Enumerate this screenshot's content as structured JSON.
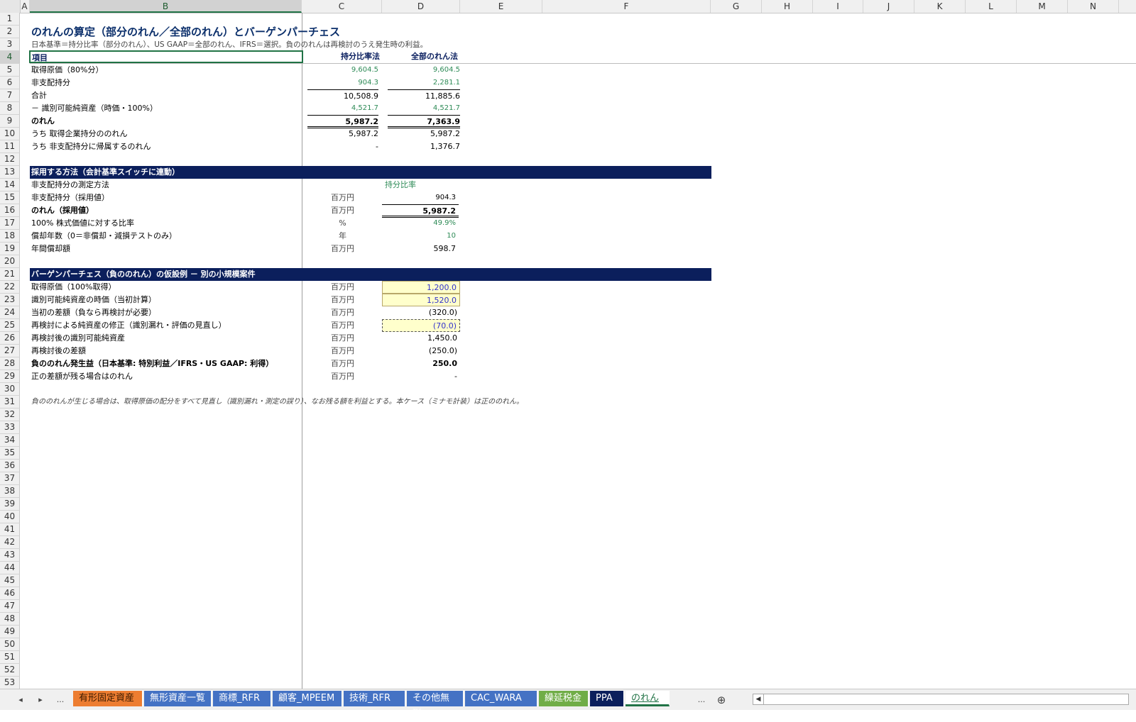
{
  "columns": [
    "A",
    "B",
    "C",
    "D",
    "E",
    "F",
    "G",
    "H",
    "I",
    "J",
    "K",
    "L",
    "M",
    "N"
  ],
  "rows": [
    "1",
    "2",
    "3",
    "4",
    "5",
    "6",
    "7",
    "8",
    "9",
    "10",
    "11",
    "12",
    "13",
    "14",
    "15",
    "16",
    "17",
    "18",
    "19",
    "20",
    "21",
    "22",
    "23",
    "24",
    "25",
    "26",
    "27",
    "28",
    "29",
    "30",
    "31",
    "32",
    "33",
    "34",
    "35",
    "36",
    "37",
    "38",
    "39",
    "40",
    "41",
    "42",
    "43",
    "44",
    "45",
    "46",
    "47",
    "48",
    "49",
    "50",
    "51",
    "52",
    "53"
  ],
  "title": "のれんの算定（部分のれん／全部のれん）とバーゲンパーチェス",
  "subtitle": "日本基準＝持分比率（部分のれん）、US GAAP＝全部のれん、IFRS＝選択。負ののれんは再検討のうえ発生時の利益。",
  "table1": {
    "header": {
      "item": "項目",
      "col_c": "持分比率法",
      "col_d": "全部のれん法"
    },
    "rows": [
      {
        "label": "取得原価（80%分）",
        "c": "9,604.5",
        "d": "9,604.5"
      },
      {
        "label": "非支配持分",
        "c": "904.3",
        "d": "2,281.1"
      },
      {
        "label": "合計",
        "c": "10,508.9",
        "d": "11,885.6"
      },
      {
        "label": "－ 識別可能純資産（時価・100%）",
        "c": "4,521.7",
        "d": "4,521.7"
      },
      {
        "label": "のれん",
        "c": "5,987.2",
        "d": "7,363.9"
      },
      {
        "label": "うち 取得企業持分ののれん",
        "c": "5,987.2",
        "d": "5,987.2"
      },
      {
        "label": "うち 非支配持分に帰属するのれん",
        "c": "-",
        "d": "1,376.7"
      }
    ]
  },
  "section2": {
    "header": "採用する方法（会計基準スイッチに連動）",
    "rows": [
      {
        "label": "非支配持分の測定方法",
        "unit": "",
        "value": "持分比率"
      },
      {
        "label": "非支配持分（採用値）",
        "unit": "百万円",
        "value": "904.3"
      },
      {
        "label": "のれん（採用値）",
        "unit": "百万円",
        "value": "5,987.2"
      },
      {
        "label": "100% 株式価値に対する比率",
        "unit": "%",
        "value": "49.9%"
      },
      {
        "label": "償却年数（0＝非償却・減損テストのみ）",
        "unit": "年",
        "value": "10"
      },
      {
        "label": "年間償却額",
        "unit": "百万円",
        "value": "598.7"
      }
    ]
  },
  "section3": {
    "header": "バーゲンパーチェス（負ののれん）の仮設例 － 別の小規模案件",
    "rows": [
      {
        "label": "取得原価（100%取得）",
        "unit": "百万円",
        "value": "1,200.0"
      },
      {
        "label": "識別可能純資産の時価（当初計算）",
        "unit": "百万円",
        "value": "1,520.0"
      },
      {
        "label": "当初の差額（負なら再検討が必要）",
        "unit": "百万円",
        "value": "(320.0)"
      },
      {
        "label": "再検討による純資産の修正（識別漏れ・評価の見直し）",
        "unit": "百万円",
        "value": "(70.0)"
      },
      {
        "label": "再検討後の識別可能純資産",
        "unit": "百万円",
        "value": "1,450.0"
      },
      {
        "label": "再検討後の差額",
        "unit": "百万円",
        "value": "(250.0)"
      },
      {
        "label": "負ののれん発生益（日本基準: 特別利益／IFRS・US GAAP: 利得）",
        "unit": "百万円",
        "value": "250.0"
      },
      {
        "label": "正の差額が残る場合はのれん",
        "unit": "百万円",
        "value": "-"
      }
    ]
  },
  "note": "負ののれんが生じる場合は、取得原価の配分をすべて見直し（識別漏れ・測定の誤り）、なお残る額を利益とする。本ケース（ミナモ計装）は正ののれん。",
  "tabs": [
    {
      "label": "有形固定資産",
      "color": "#ed7d31"
    },
    {
      "label": "無形資産一覧",
      "color": "#4472c4"
    },
    {
      "label": "商標_RFR",
      "color": "#4472c4"
    },
    {
      "label": "顧客_MPEEM",
      "color": "#4472c4"
    },
    {
      "label": "技術_RFR",
      "color": "#4472c4"
    },
    {
      "label": "その他無形",
      "color": "#4472c4"
    },
    {
      "label": "CAC_WARA",
      "color": "#4472c4"
    },
    {
      "label": "繰延税金",
      "color": "#70ad47"
    },
    {
      "label": "PPA",
      "color": "#0b1f5c"
    },
    {
      "label": "のれん",
      "color": "#ffffff"
    }
  ],
  "tabnav": {
    "prev": "◂",
    "next": "▸",
    "more_left": "...",
    "more_right": "...",
    "add": "⊕"
  },
  "colors": {
    "accent": "#217346",
    "band": "#0b1f5c",
    "input_fill": "#ffffcc",
    "green_text": "#2e8b57",
    "blue_text": "#3333cc"
  }
}
